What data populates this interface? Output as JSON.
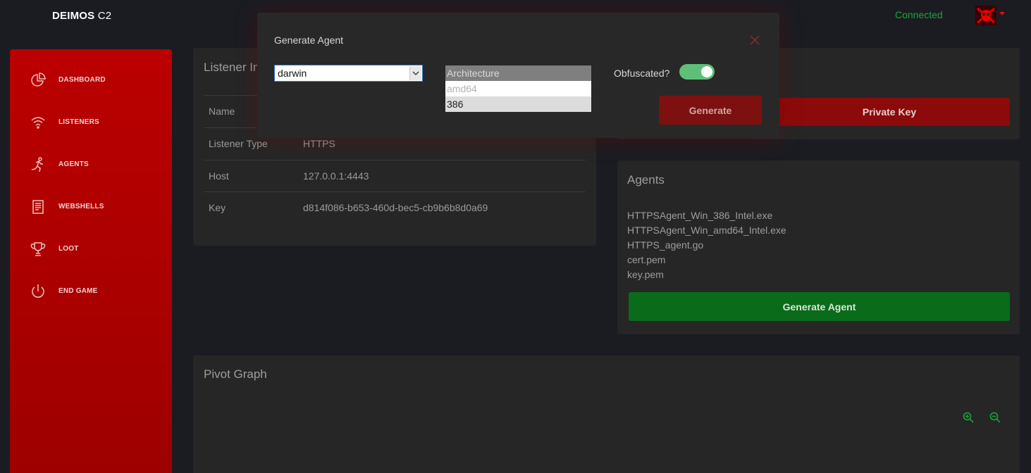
{
  "brand": {
    "bold": "DEIMOS",
    "rest": " C2"
  },
  "header": {
    "status": "Connected",
    "avatar_icon": "skull-avatar-icon"
  },
  "sidebar": {
    "items": [
      {
        "label": "DASHBOARD",
        "icon": "pie-chart-icon"
      },
      {
        "label": "LISTENERS",
        "icon": "wifi-icon"
      },
      {
        "label": "AGENTS",
        "icon": "running-man-icon"
      },
      {
        "label": "WEBSHELLS",
        "icon": "document-icon"
      },
      {
        "label": "LOOT",
        "icon": "trophy-icon"
      },
      {
        "label": "END GAME",
        "icon": "power-icon"
      }
    ]
  },
  "listener": {
    "title": "Listener In",
    "rows": [
      {
        "key": "Name",
        "value": ""
      },
      {
        "key": "Listener Type",
        "value": "HTTPS"
      },
      {
        "key": "Host",
        "value": "127.0.0.1:4443"
      },
      {
        "key": "Key",
        "value": "d814f086-b653-460d-bec5-cb9b6b8d0a69"
      }
    ]
  },
  "keys": {
    "private_key_label": "Private Key"
  },
  "agents": {
    "title": "Agents",
    "files": [
      "HTTPSAgent_Win_386_Intel.exe",
      "HTTPSAgent_Win_amd64_Intel.exe",
      "HTTPS_agent.go",
      "cert.pem",
      "key.pem"
    ],
    "generate_label": "Generate Agent"
  },
  "pivot": {
    "title": "Pivot Graph"
  },
  "modal": {
    "title": "Generate Agent",
    "os_value": "darwin",
    "arch_options": [
      "Architecture",
      "amd64",
      "386"
    ],
    "obfuscated_label": "Obfuscated?",
    "obfuscated_on": true,
    "generate_label": "Generate"
  },
  "colors": {
    "accent_red": "#bb0000",
    "success_green": "#0a6b1b",
    "status_green": "#1aa33a",
    "toggle_green": "#5fbf78",
    "background": "#1b1c22",
    "card": "#262626"
  }
}
